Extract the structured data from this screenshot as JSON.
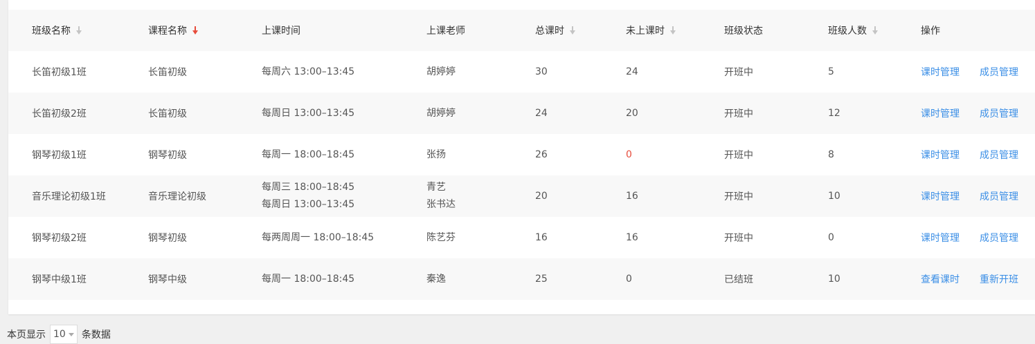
{
  "table": {
    "headers": [
      {
        "label": "班级名称",
        "sort": "idle"
      },
      {
        "label": "课程名称",
        "sort": "active"
      },
      {
        "label": "上课时间",
        "sort": "none"
      },
      {
        "label": "上课老师",
        "sort": "none"
      },
      {
        "label": "总课时",
        "sort": "idle"
      },
      {
        "label": "未上课时",
        "sort": "idle"
      },
      {
        "label": "班级状态",
        "sort": "none"
      },
      {
        "label": "班级人数",
        "sort": "idle"
      },
      {
        "label": "操作",
        "sort": "none"
      }
    ],
    "rows": [
      {
        "class_name": "长笛初级1班",
        "course": "长笛初级",
        "times": [
          "每周六 13:00–13:45"
        ],
        "teachers": [
          "胡婷婷"
        ],
        "total": "30",
        "remaining": "24",
        "remaining_alert": false,
        "status": "开班中",
        "students": "5",
        "actions": [
          "课时管理",
          "成员管理"
        ]
      },
      {
        "class_name": "长笛初级2班",
        "course": "长笛初级",
        "times": [
          "每周日 13:00–13:45"
        ],
        "teachers": [
          "胡婷婷"
        ],
        "total": "24",
        "remaining": "20",
        "remaining_alert": false,
        "status": "开班中",
        "students": "12",
        "actions": [
          "课时管理",
          "成员管理"
        ]
      },
      {
        "class_name": "钢琴初级1班",
        "course": "钢琴初级",
        "times": [
          "每周一 18:00–18:45"
        ],
        "teachers": [
          "张扬"
        ],
        "total": "26",
        "remaining": "0",
        "remaining_alert": true,
        "status": "开班中",
        "students": "8",
        "actions": [
          "课时管理",
          "成员管理"
        ]
      },
      {
        "class_name": "音乐理论初级1班",
        "course": "音乐理论初级",
        "times": [
          "每周三 18:00–18:45",
          "每周日 13:00–13:45"
        ],
        "teachers": [
          "青艺",
          "张书达"
        ],
        "total": "20",
        "remaining": "16",
        "remaining_alert": false,
        "status": "开班中",
        "students": "10",
        "actions": [
          "课时管理",
          "成员管理"
        ]
      },
      {
        "class_name": "钢琴初级2班",
        "course": "钢琴初级",
        "times": [
          "每两周周一 18:00–18:45"
        ],
        "teachers": [
          "陈艺芬"
        ],
        "total": "16",
        "remaining": "16",
        "remaining_alert": false,
        "status": "开班中",
        "students": "0",
        "actions": [
          "课时管理",
          "成员管理"
        ]
      },
      {
        "class_name": "钢琴中级1班",
        "course": "钢琴中级",
        "times": [
          "每周一 18:00–18:45"
        ],
        "teachers": [
          "秦逸"
        ],
        "total": "25",
        "remaining": "0",
        "remaining_alert": false,
        "status": "已结班",
        "students": "10",
        "actions": [
          "查看课时",
          "重新开班"
        ]
      }
    ]
  },
  "pager": {
    "prefix": "本页显示",
    "page_size": "10",
    "suffix": "条数据"
  },
  "colors": {
    "link": "#3a8ee6",
    "alert": "#e74c3c",
    "sort_active": "#e74c3c",
    "sort_idle": "#c4c4c4"
  },
  "icons": {
    "sort_idle": "arrow-down-icon",
    "sort_active": "arrow-down-icon",
    "page_size_caret": "caret-down-icon"
  }
}
